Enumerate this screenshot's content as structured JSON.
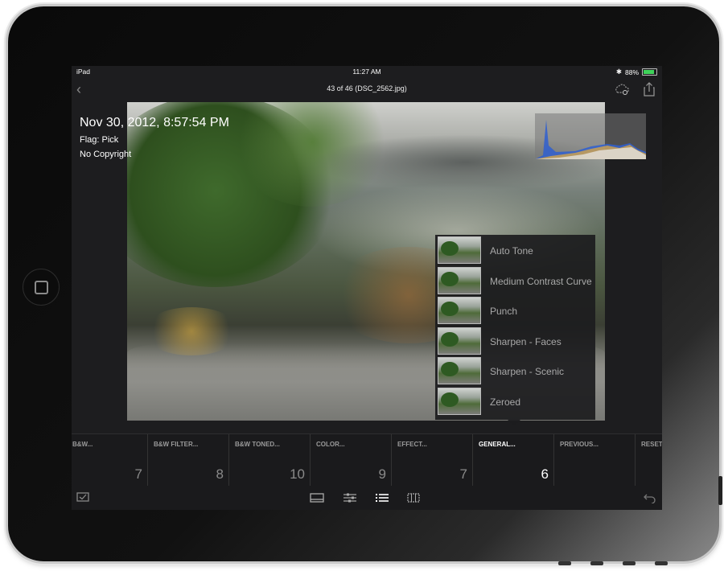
{
  "status_bar": {
    "device": "iPad",
    "time": "11:27 AM",
    "battery": "88%"
  },
  "header": {
    "title": "43 of 46 (DSC_2562.jpg)"
  },
  "photo_info": {
    "date": "Nov 30, 2012, 8:57:54 PM",
    "flag": "Flag: Pick",
    "copyright": "No Copyright"
  },
  "presets": [
    {
      "label": "Auto Tone"
    },
    {
      "label": "Medium Contrast Curve"
    },
    {
      "label": "Punch"
    },
    {
      "label": "Sharpen - Faces"
    },
    {
      "label": "Sharpen - Scenic"
    },
    {
      "label": "Zeroed"
    }
  ],
  "preset_categories": [
    {
      "label": "B&W...",
      "count": "7"
    },
    {
      "label": "B&W FILTER...",
      "count": "8"
    },
    {
      "label": "B&W TONED...",
      "count": "10"
    },
    {
      "label": "COLOR...",
      "count": "9"
    },
    {
      "label": "EFFECT...",
      "count": "7"
    },
    {
      "label": "GENERAL...",
      "count": "6"
    },
    {
      "label": "PREVIOUS...",
      "count": ""
    },
    {
      "label": "RESET",
      "count": ""
    }
  ],
  "icons": {
    "back": "chevron-left-icon",
    "cloud": "cloud-sync-icon",
    "share": "share-icon",
    "flag": "flag-icon",
    "crop": "crop-icon",
    "adjust": "sliders-icon",
    "presets": "list-icon",
    "grid": "grid-icon",
    "undo": "undo-icon"
  },
  "colors": {
    "accent_battery": "#3fd25a",
    "background": "#1d1d1f"
  }
}
